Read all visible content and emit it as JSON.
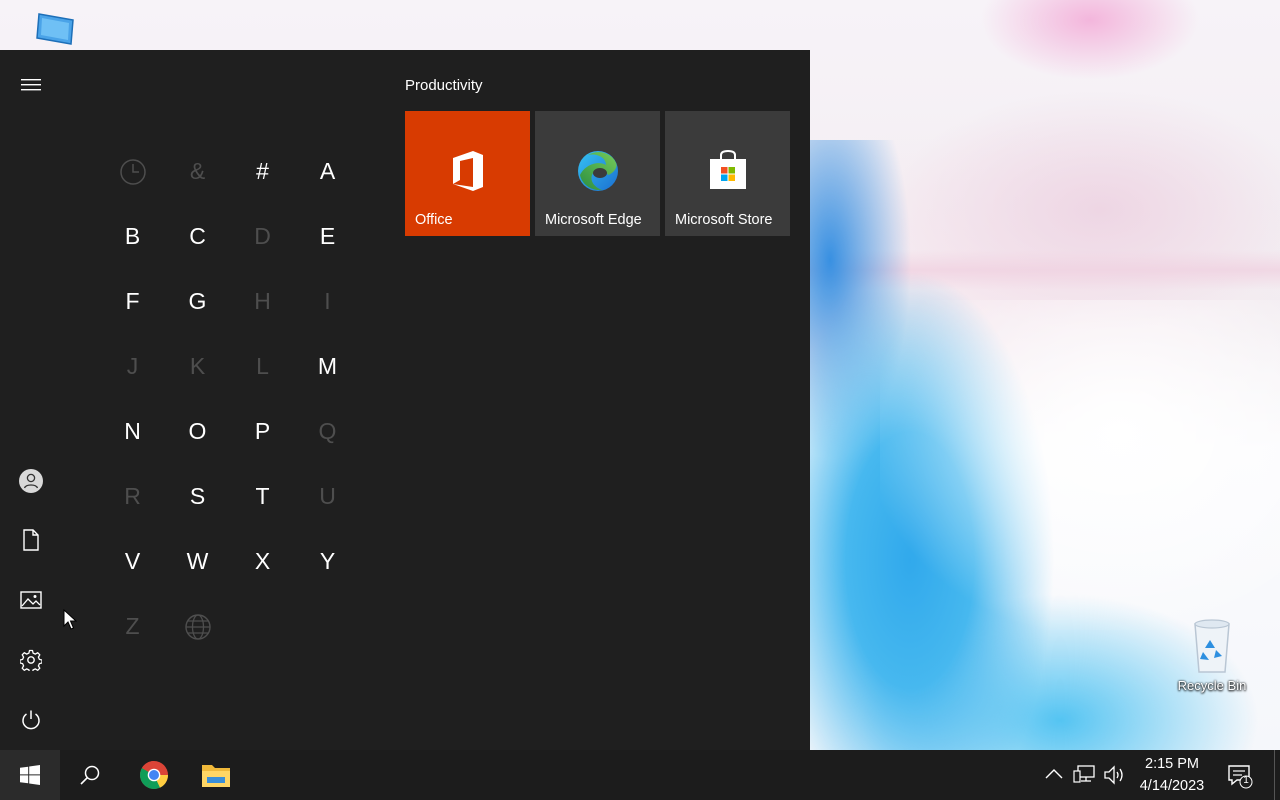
{
  "desktop": {
    "icons": [
      {
        "label": "",
        "icon": "this-pc-icon"
      },
      {
        "label": "Recycle Bin",
        "icon": "recycle-bin-icon"
      }
    ]
  },
  "start_menu": {
    "rail": {
      "items": [
        "hamburger-menu-icon",
        "user-account-icon",
        "documents-icon",
        "pictures-icon",
        "settings-gear-icon",
        "power-icon"
      ]
    },
    "jump_list": {
      "letters": [
        {
          "text": "",
          "icon": "recent-clock-icon",
          "enabled": false
        },
        {
          "text": "&",
          "enabled": false
        },
        {
          "text": "#",
          "enabled": true
        },
        {
          "text": "A",
          "enabled": true
        },
        {
          "text": "B",
          "enabled": true
        },
        {
          "text": "C",
          "enabled": true
        },
        {
          "text": "D",
          "enabled": false
        },
        {
          "text": "E",
          "enabled": true
        },
        {
          "text": "F",
          "enabled": true
        },
        {
          "text": "G",
          "enabled": true
        },
        {
          "text": "H",
          "enabled": false
        },
        {
          "text": "I",
          "enabled": false
        },
        {
          "text": "J",
          "enabled": false
        },
        {
          "text": "K",
          "enabled": false
        },
        {
          "text": "L",
          "enabled": false
        },
        {
          "text": "M",
          "enabled": true
        },
        {
          "text": "N",
          "enabled": true
        },
        {
          "text": "O",
          "enabled": true
        },
        {
          "text": "P",
          "enabled": true
        },
        {
          "text": "Q",
          "enabled": false
        },
        {
          "text": "R",
          "enabled": false
        },
        {
          "text": "S",
          "enabled": true
        },
        {
          "text": "T",
          "enabled": true
        },
        {
          "text": "U",
          "enabled": false
        },
        {
          "text": "V",
          "enabled": true
        },
        {
          "text": "W",
          "enabled": true
        },
        {
          "text": "X",
          "enabled": true
        },
        {
          "text": "Y",
          "enabled": true
        },
        {
          "text": "Z",
          "enabled": false
        },
        {
          "text": "",
          "icon": "globe-icon",
          "enabled": false
        }
      ]
    },
    "tiles": {
      "group_title": "Productivity",
      "items": [
        {
          "label": "Office",
          "icon": "office-icon",
          "color": "#d83b01"
        },
        {
          "label": "Microsoft Edge",
          "icon": "edge-icon",
          "color": "#3b3b3b"
        },
        {
          "label": "Microsoft Store",
          "icon": "store-icon",
          "color": "#3b3b3b"
        }
      ]
    }
  },
  "taskbar": {
    "pinned": [
      "windows-start-icon",
      "search-icon",
      "chrome-icon",
      "file-explorer-icon"
    ],
    "tray": [
      "show-hidden-icons-chevron",
      "network-icon",
      "volume-icon"
    ],
    "clock": {
      "time": "2:15 PM",
      "date": "4/14/2023"
    },
    "notifications": {
      "icon": "action-center-icon",
      "count": "1"
    }
  }
}
